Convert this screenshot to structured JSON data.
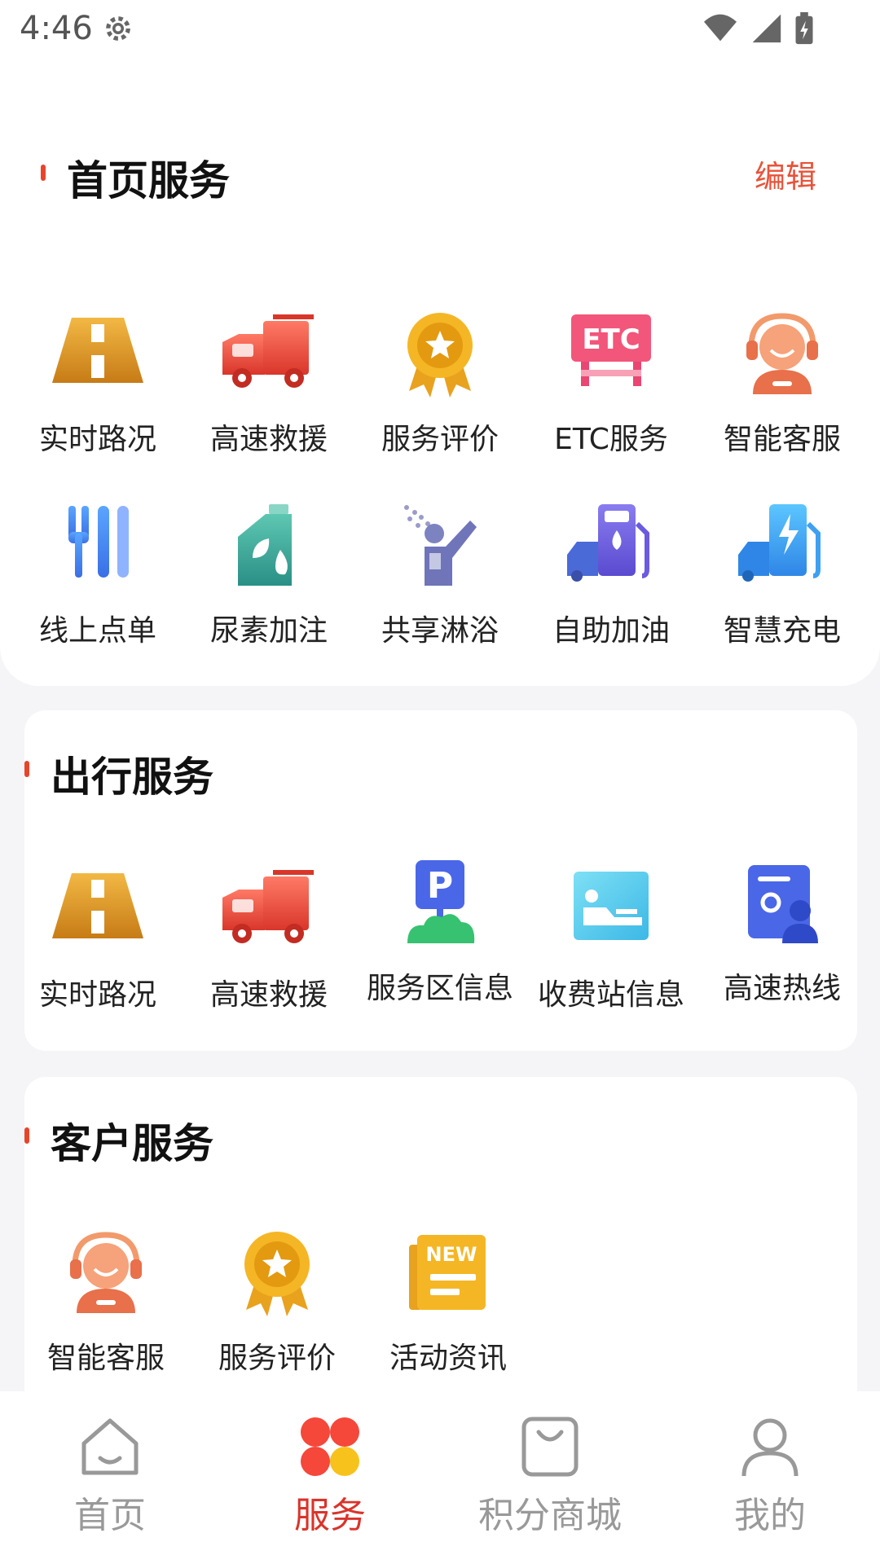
{
  "status": {
    "time": "4:46"
  },
  "home_services": {
    "title": "首页服务",
    "edit_label": "编辑",
    "items": [
      {
        "label": "实时路况",
        "icon": "road-icon"
      },
      {
        "label": "高速救援",
        "icon": "tow-truck-icon"
      },
      {
        "label": "服务评价",
        "icon": "medal-icon"
      },
      {
        "label": "ETC服务",
        "icon": "etc-icon"
      },
      {
        "label": "智能客服",
        "icon": "customer-service-icon"
      },
      {
        "label": "线上点单",
        "icon": "fork-knife-icon"
      },
      {
        "label": "尿素加注",
        "icon": "urea-icon"
      },
      {
        "label": "共享淋浴",
        "icon": "shower-icon"
      },
      {
        "label": "自助加油",
        "icon": "fuel-icon"
      },
      {
        "label": "智慧充电",
        "icon": "ev-charging-icon"
      }
    ]
  },
  "travel_services": {
    "title": "出行服务",
    "items": [
      {
        "label": "实时路况",
        "icon": "road-icon"
      },
      {
        "label": "高速救援",
        "icon": "tow-truck-icon"
      },
      {
        "label": "服务区信息",
        "icon": "parking-icon"
      },
      {
        "label": "收费站信息",
        "icon": "toll-station-icon"
      },
      {
        "label": "高速热线",
        "icon": "hotline-icon"
      }
    ]
  },
  "customer_services": {
    "title": "客户服务",
    "items": [
      {
        "label": "智能客服",
        "icon": "customer-service-icon"
      },
      {
        "label": "服务评价",
        "icon": "medal-icon"
      },
      {
        "label": "活动资讯",
        "icon": "news-icon"
      }
    ]
  },
  "tabbar": {
    "tabs": [
      {
        "label": "首页",
        "icon": "home-icon"
      },
      {
        "label": "服务",
        "icon": "services-icon"
      },
      {
        "label": "积分商城",
        "icon": "shopping-bag-icon"
      },
      {
        "label": "我的",
        "icon": "profile-icon"
      }
    ],
    "active": "服务"
  },
  "colors": {
    "accent": "#e8442c",
    "active_tab": "#d9342b",
    "inactive_tab": "#999999"
  }
}
